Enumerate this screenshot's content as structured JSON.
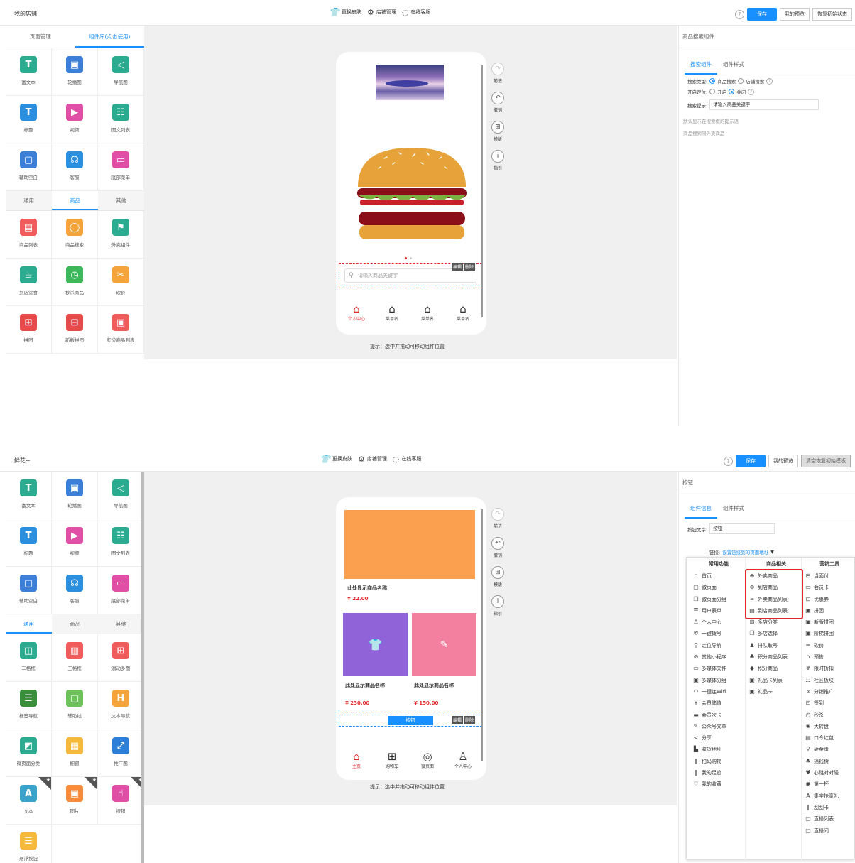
{
  "screen1": {
    "topbar": {
      "shop_name": "我的店铺",
      "tools": [
        "更换皮肤",
        "店铺管理",
        "在线客服"
      ],
      "help": "?",
      "save": "保存",
      "preview": "我的预览",
      "restore": "恢复初始状态"
    },
    "left_tabs": [
      "页面管理",
      "组件库(点击使用)"
    ],
    "grid_a": [
      {
        "label": "富文本",
        "icon": "T",
        "color": "#2bab8f"
      },
      {
        "label": "轮播图",
        "icon": "▣",
        "color": "#3b7fd9"
      },
      {
        "label": "导航图",
        "icon": "◁",
        "color": "#2bab8f"
      },
      {
        "label": "标题",
        "icon": "T",
        "color": "#2b8fe0"
      },
      {
        "label": "视频",
        "icon": "▶",
        "color": "#e04ea6"
      },
      {
        "label": "图文列表",
        "icon": "☷",
        "color": "#2bab8f"
      },
      {
        "label": "辅助空白",
        "icon": "▢",
        "color": "#3b7fd9"
      },
      {
        "label": "客服",
        "icon": "☊",
        "color": "#2b8fe0"
      },
      {
        "label": "底部菜单",
        "icon": "▭",
        "color": "#e04ea6"
      }
    ],
    "sub_tabs": [
      "通用",
      "商品",
      "其他"
    ],
    "grid_b": [
      {
        "label": "商品列表",
        "icon": "▤",
        "color": "#f05b5b"
      },
      {
        "label": "商品搜索",
        "icon": "◯",
        "color": "#f5a33b"
      },
      {
        "label": "外卖组件",
        "icon": "⚑",
        "color": "#2bab8f"
      },
      {
        "label": "到店堂食",
        "icon": "☕",
        "color": "#2bab8f"
      },
      {
        "label": "秒杀商品",
        "icon": "◷",
        "color": "#3cb85a"
      },
      {
        "label": "砍价",
        "icon": "✂",
        "color": "#f5a33b"
      },
      {
        "label": "拼团",
        "icon": "⊞",
        "color": "#e84a4a"
      },
      {
        "label": "新版拼团",
        "icon": "⊟",
        "color": "#e84a4a"
      },
      {
        "label": "积分商品列表",
        "icon": "▣",
        "color": "#f05b5b"
      }
    ],
    "tools": [
      {
        "label": "前进",
        "icon": "↷"
      },
      {
        "label": "撤销",
        "icon": "↶"
      },
      {
        "label": "模版",
        "icon": "⊞"
      },
      {
        "label": "指引",
        "icon": "i"
      }
    ],
    "search_placeholder": "请输入商品关键字",
    "edit": "编辑",
    "delete": "删除",
    "nav": [
      {
        "label": "个人中心",
        "icon": "⌂"
      },
      {
        "label": "菜单名",
        "icon": "⌂"
      },
      {
        "label": "菜单名",
        "icon": "⌂"
      },
      {
        "label": "菜单名",
        "icon": "⌂"
      }
    ],
    "hint": "提示：选中并拖动可移动组件位置",
    "right": {
      "title": "商品搜索组件",
      "tabs": [
        "搜索组件",
        "组件样式"
      ],
      "type_label": "搜索类型:",
      "type_opts": [
        "商品搜索",
        "店铺搜索"
      ],
      "locate_label": "开启定位:",
      "locate_opts": [
        "开启",
        "关闭"
      ],
      "prompt_label": "搜索提示:",
      "prompt_value": "请输入商品关键字",
      "note1": "默认显示在搜索框的提示语",
      "note2": "商品搜索限外卖商品"
    }
  },
  "screen2": {
    "topbar": {
      "shop_name": "鲜花+",
      "tools": [
        "更换皮肤",
        "店铺管理",
        "在线客服"
      ],
      "help": "?",
      "save": "保存",
      "preview": "我的预览",
      "restore": "清空恢复初始模板"
    },
    "grid_a": [
      {
        "label": "富文本",
        "icon": "T",
        "color": "#2bab8f"
      },
      {
        "label": "轮播图",
        "icon": "▣",
        "color": "#3b7fd9"
      },
      {
        "label": "导航图",
        "icon": "◁",
        "color": "#2bab8f"
      },
      {
        "label": "标题",
        "icon": "T",
        "color": "#2b8fe0"
      },
      {
        "label": "视频",
        "icon": "▶",
        "color": "#e04ea6"
      },
      {
        "label": "图文列表",
        "icon": "☷",
        "color": "#2bab8f"
      },
      {
        "label": "辅助空白",
        "icon": "▢",
        "color": "#3b7fd9"
      },
      {
        "label": "客服",
        "icon": "☊",
        "color": "#2b8fe0"
      },
      {
        "label": "底部菜单",
        "icon": "▭",
        "color": "#e04ea6"
      }
    ],
    "sub_tabs": [
      "通用",
      "商品",
      "其他"
    ],
    "grid_b": [
      {
        "label": "二格框",
        "icon": "◫",
        "color": "#2bab8f"
      },
      {
        "label": "三格框",
        "icon": "▥",
        "color": "#f05b5b"
      },
      {
        "label": "滑动多图",
        "icon": "⊞",
        "color": "#f05b5b"
      },
      {
        "label": "标签导航",
        "icon": "☰",
        "color": "#3a8f3a"
      },
      {
        "label": "辅助线",
        "icon": "▢",
        "color": "#6dc25a"
      },
      {
        "label": "文本导航",
        "icon": "H",
        "color": "#f5a33b"
      },
      {
        "label": "微页面分类",
        "icon": "◩",
        "color": "#2bab8f"
      },
      {
        "label": "橱窗",
        "icon": "▦",
        "color": "#f5b93b"
      },
      {
        "label": "推广图",
        "icon": "⤢",
        "color": "#2b7fd9"
      },
      {
        "label": "文本",
        "icon": "A",
        "color": "#3aa3c9",
        "star": true
      },
      {
        "label": "图片",
        "icon": "▣",
        "color": "#f58b3b",
        "star": true
      },
      {
        "label": "按钮",
        "icon": "☝",
        "color": "#e04ea6",
        "star": true
      },
      {
        "label": "悬浮按钮",
        "icon": "☰",
        "color": "#f5b93b"
      }
    ],
    "tools": [
      {
        "label": "前进",
        "icon": "↷"
      },
      {
        "label": "撤销",
        "icon": "↶"
      },
      {
        "label": "模版",
        "icon": "⊞"
      },
      {
        "label": "指引",
        "icon": "i"
      }
    ],
    "product1": {
      "name": "此处显示商品名称",
      "price": "¥ 22.00",
      "color": "#fba04f"
    },
    "product2": {
      "name": "此处显示商品名称",
      "price": "¥ 230.00",
      "color": "#9163d8",
      "icon": "👕"
    },
    "product3": {
      "name": "此处显示商品名称",
      "price": "¥ 150.00",
      "color": "#f3809f",
      "icon": "✎"
    },
    "button_label": "按钮",
    "edit": "编辑",
    "delete": "删除",
    "nav": [
      {
        "label": "主页",
        "icon": "⌂"
      },
      {
        "label": "购物车",
        "icon": "⊞"
      },
      {
        "label": "微页面",
        "icon": "◎"
      },
      {
        "label": "个人中心",
        "icon": "♙"
      }
    ],
    "hint": "提示：选中并拖动可移动组件位置",
    "right": {
      "title": "按钮",
      "tabs": [
        "组件信息",
        "组件样式"
      ],
      "btn_text_label": "按钮文字:",
      "btn_text_value": "按钮",
      "link_label": "链接:",
      "link_value": "设置链接到的页面地址"
    },
    "menu": {
      "col1_head": "常用功能",
      "col1": [
        {
          "t": "首页",
          "i": "⌂"
        },
        {
          "t": "微页面",
          "i": "▢"
        },
        {
          "t": "微页面分组",
          "i": "❐"
        },
        {
          "t": "用户表单",
          "i": "☰"
        },
        {
          "t": "个人中心",
          "i": "♙"
        },
        {
          "t": "一键拨号",
          "i": "✆"
        },
        {
          "t": "定位导航",
          "i": "⚲"
        },
        {
          "t": "其他小程序",
          "i": "⊘"
        },
        {
          "t": "多媒体文件",
          "i": "▭"
        },
        {
          "t": "多媒体分组",
          "i": "▣"
        },
        {
          "t": "一键连Wifi",
          "i": "◠"
        },
        {
          "t": "会员储值",
          "i": "¥"
        },
        {
          "t": "会员次卡",
          "i": "▬"
        },
        {
          "t": "公众号文章",
          "i": "✎"
        },
        {
          "t": "分享",
          "i": "<"
        },
        {
          "t": "收货地址",
          "i": "▙"
        },
        {
          "t": "扫码购物",
          "i": "∥"
        },
        {
          "t": "我的足迹",
          "i": "∥"
        },
        {
          "t": "我的收藏",
          "i": "♡"
        }
      ],
      "col2_head": "商品相关",
      "col2": [
        {
          "t": "外卖商品",
          "i": "⊕"
        },
        {
          "t": "到店商品",
          "i": "⊕"
        },
        {
          "t": "外卖商品列表",
          "i": "∞"
        },
        {
          "t": "到店商品列表",
          "i": "▤"
        },
        {
          "t": "多店分类",
          "i": "⊞"
        },
        {
          "t": "多店选择",
          "i": "❐"
        },
        {
          "t": "排队取号",
          "i": "♟"
        },
        {
          "t": "积分商品列表",
          "i": "♣"
        },
        {
          "t": "积分商品",
          "i": "◆"
        },
        {
          "t": "礼品卡列表",
          "i": "▣"
        },
        {
          "t": "礼品卡",
          "i": "▣"
        }
      ],
      "col3_head": "营销工具",
      "col3": [
        {
          "t": "当面付",
          "i": "⊟"
        },
        {
          "t": "会员卡",
          "i": "▭"
        },
        {
          "t": "优惠券",
          "i": "⊡"
        },
        {
          "t": "拼团",
          "i": "▣"
        },
        {
          "t": "新版拼团",
          "i": "▣"
        },
        {
          "t": "阶梯拼团",
          "i": "▣"
        },
        {
          "t": "砍价",
          "i": "✂"
        },
        {
          "t": "预售",
          "i": "⌂"
        },
        {
          "t": "限时折扣",
          "i": "♅"
        },
        {
          "t": "社区板块",
          "i": "☷"
        },
        {
          "t": "分销推广",
          "i": "∝"
        },
        {
          "t": "签到",
          "i": "⊡"
        },
        {
          "t": "秒杀",
          "i": "◷"
        },
        {
          "t": "大转盘",
          "i": "❀"
        },
        {
          "t": "口令红包",
          "i": "▤"
        },
        {
          "t": "砸金蛋",
          "i": "⚲"
        },
        {
          "t": "摇钱树",
          "i": "♣"
        },
        {
          "t": "心跳对对碰",
          "i": "♥"
        },
        {
          "t": "第一杯",
          "i": "◉"
        },
        {
          "t": "集字抢豪礼",
          "i": "A"
        },
        {
          "t": "刮刮卡",
          "i": "∥"
        },
        {
          "t": "直播列表",
          "i": "▢"
        },
        {
          "t": "直播间",
          "i": "▢"
        }
      ]
    }
  },
  "colors": {
    "accent": "#1890ff",
    "danger": "#e8272d",
    "price": "#e8272d"
  }
}
